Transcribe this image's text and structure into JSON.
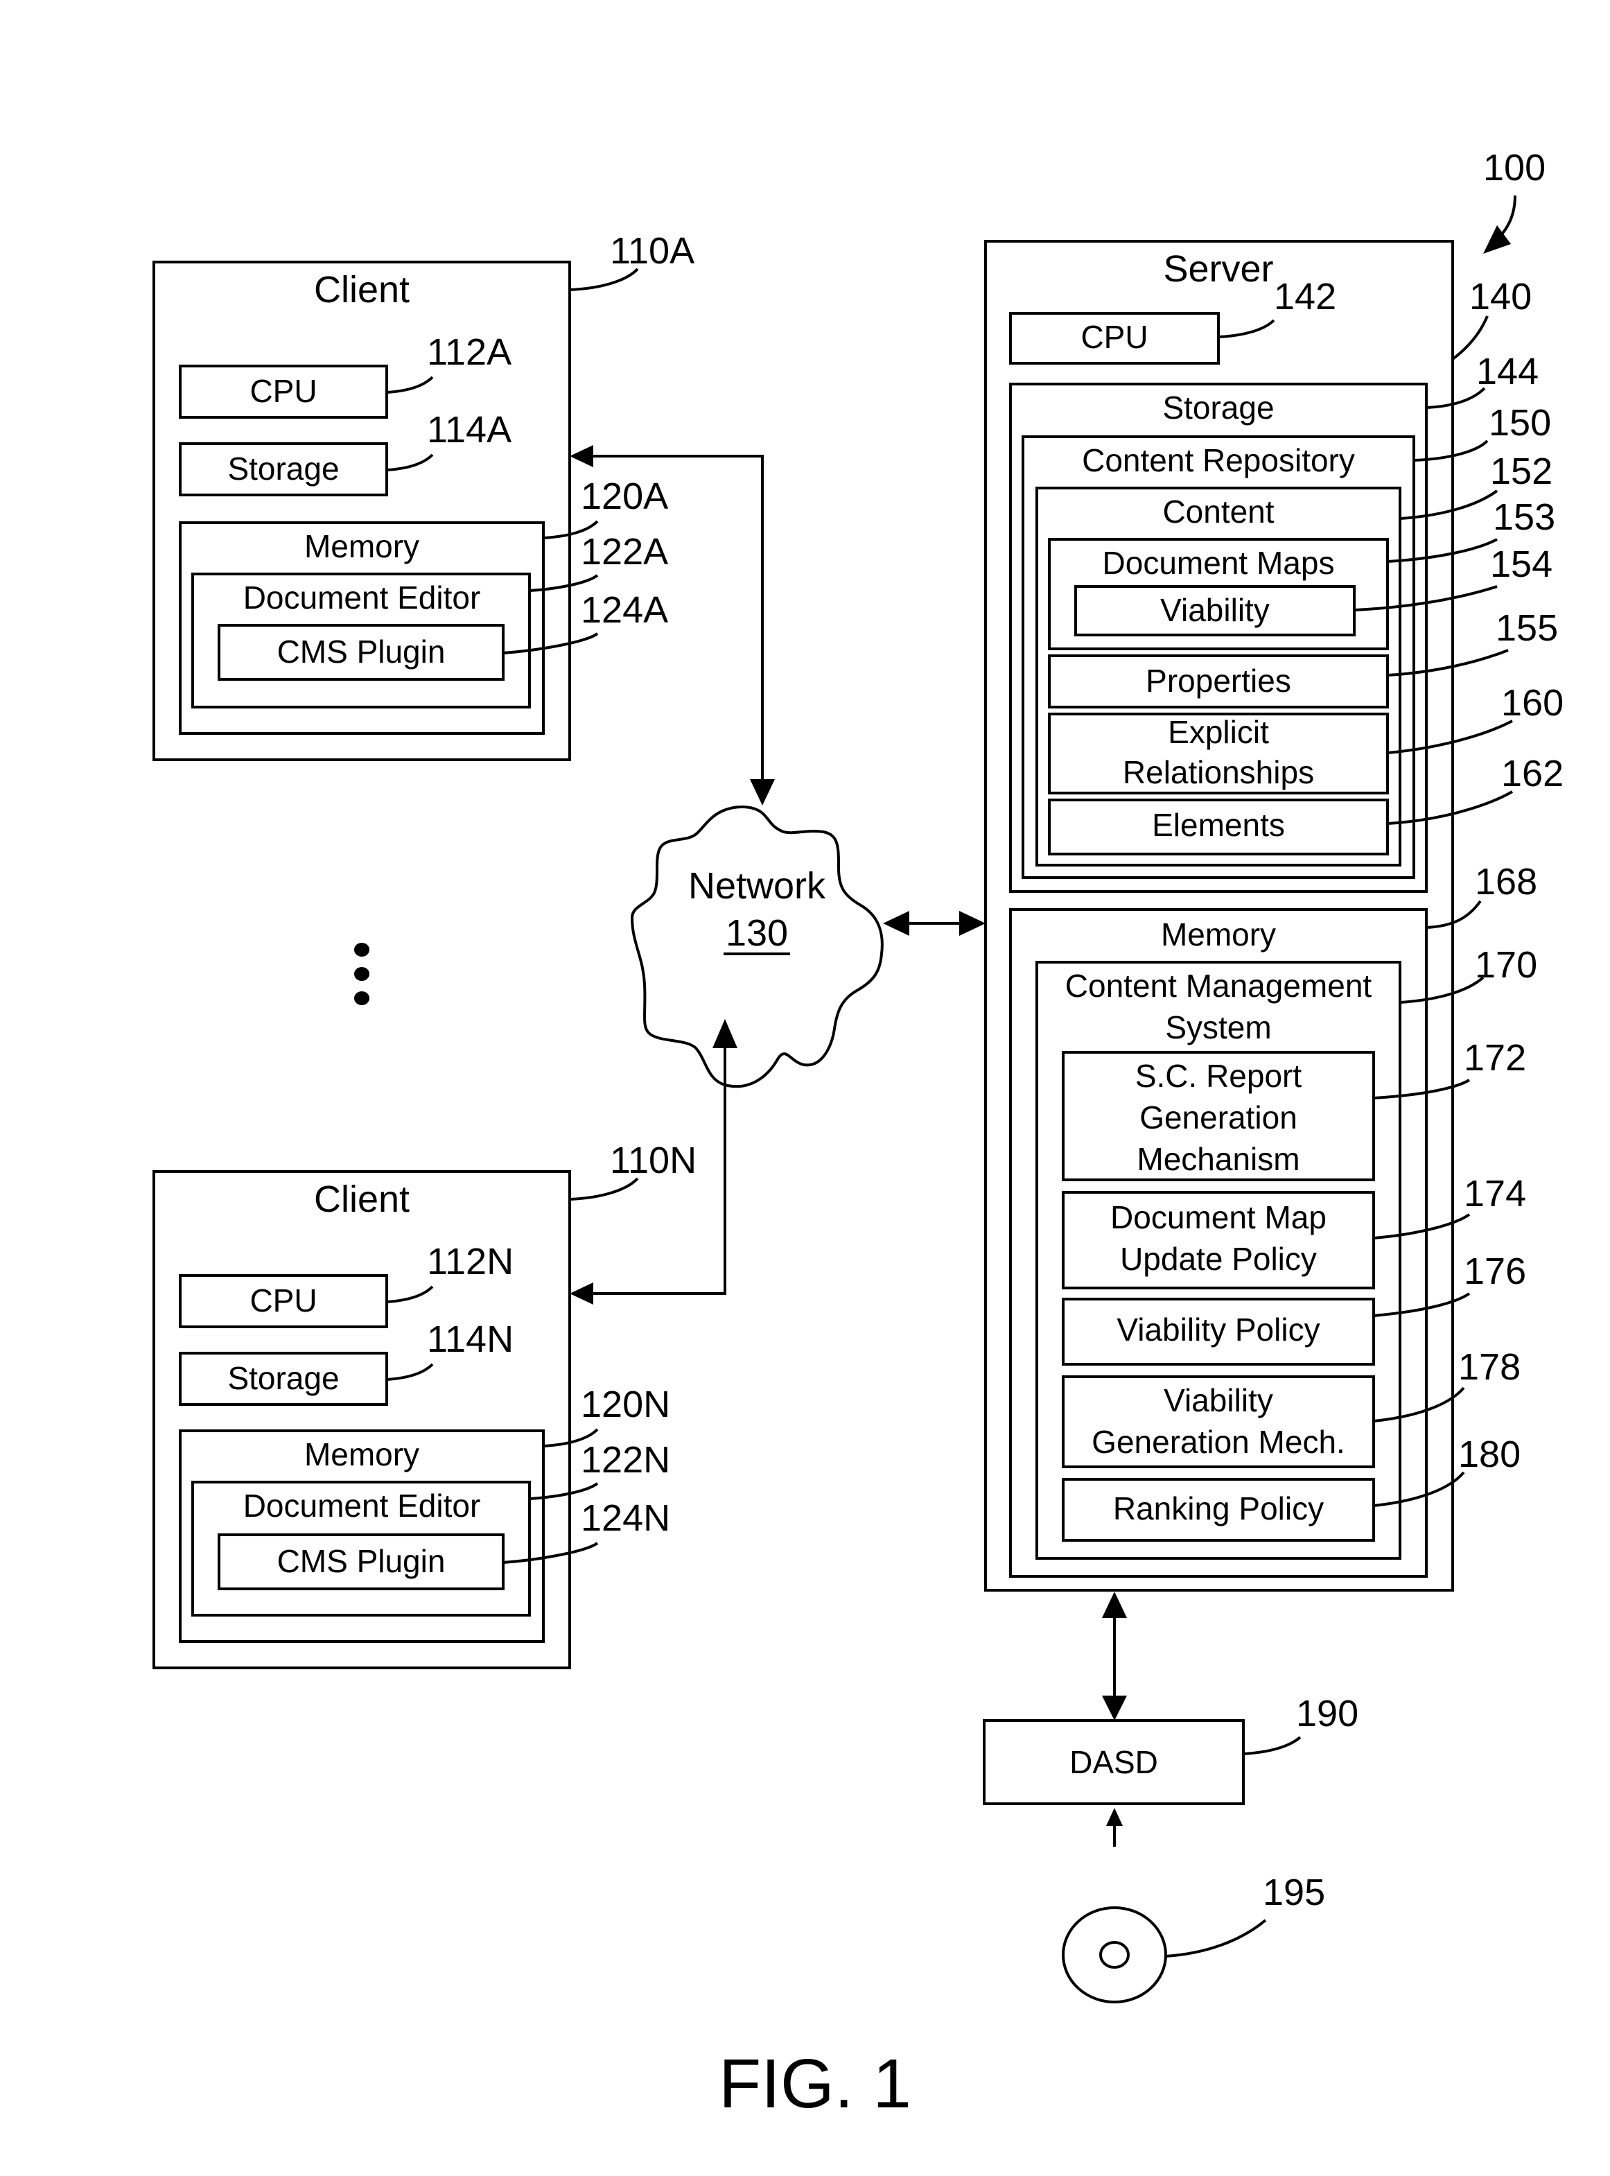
{
  "figure": {
    "system_ref": "100",
    "caption": "FIG. 1"
  },
  "client_a": {
    "title": "Client",
    "ref": "110A",
    "cpu": {
      "label": "CPU",
      "ref": "112A"
    },
    "storage": {
      "label": "Storage",
      "ref": "114A"
    },
    "memory": {
      "label": "Memory",
      "ref": "120A"
    },
    "editor": {
      "label": "Document Editor",
      "ref": "122A"
    },
    "plugin": {
      "label": "CMS Plugin",
      "ref": "124A"
    }
  },
  "client_n": {
    "title": "Client",
    "ref": "110N",
    "cpu": {
      "label": "CPU",
      "ref": "112N"
    },
    "storage": {
      "label": "Storage",
      "ref": "114N"
    },
    "memory": {
      "label": "Memory",
      "ref": "120N"
    },
    "editor": {
      "label": "Document Editor",
      "ref": "122N"
    },
    "plugin": {
      "label": "CMS Plugin",
      "ref": "124N"
    }
  },
  "network": {
    "label": "Network",
    "ref": "130"
  },
  "server": {
    "title": "Server",
    "ref": "140",
    "cpu": {
      "label": "CPU",
      "ref": "142"
    },
    "storage": {
      "label": "Storage",
      "ref": "144"
    },
    "repository": {
      "label": "Content Repository",
      "ref": "150"
    },
    "content": {
      "label": "Content",
      "ref": "152"
    },
    "document_maps": {
      "label": "Document Maps",
      "ref": "153"
    },
    "viability": {
      "label": "Viability",
      "ref": "154"
    },
    "properties": {
      "label": "Properties",
      "ref": "155"
    },
    "explicit_relationships": {
      "line1": "Explicit",
      "line2": "Relationships",
      "ref": "160"
    },
    "elements": {
      "label": "Elements",
      "ref": "162"
    },
    "memory": {
      "label": "Memory",
      "ref": "168"
    },
    "cms": {
      "line1": "Content Management",
      "line2": "System",
      "ref": "170"
    },
    "sc_report": {
      "line1": "S.C. Report",
      "line2": "Generation",
      "line3": "Mechanism",
      "ref": "172"
    },
    "doc_map_update": {
      "line1": "Document Map",
      "line2": "Update Policy",
      "ref": "174"
    },
    "viability_policy": {
      "label": "Viability Policy",
      "ref": "176"
    },
    "viability_gen": {
      "line1": "Viability",
      "line2": "Generation Mech.",
      "ref": "178"
    },
    "ranking_policy": {
      "label": "Ranking Policy",
      "ref": "180"
    }
  },
  "dasd": {
    "label": "DASD",
    "ref": "190"
  },
  "media": {
    "ref": "195"
  }
}
